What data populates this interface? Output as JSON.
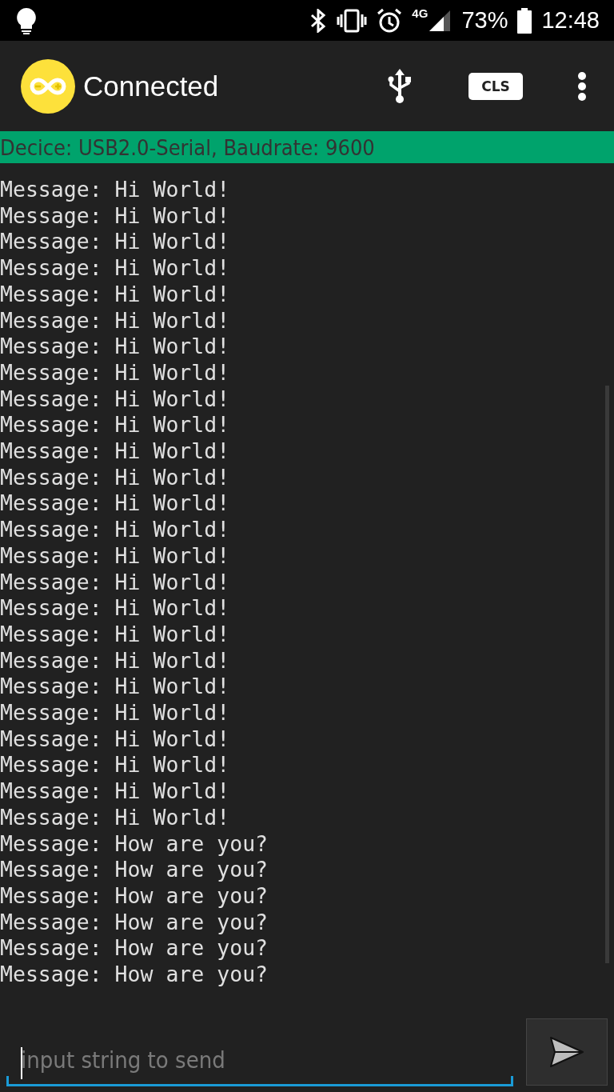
{
  "status_bar": {
    "network": "4G",
    "battery": "73%",
    "time": "12:48"
  },
  "app_bar": {
    "title": "Connected",
    "clear_button": "CLS"
  },
  "device_bar": {
    "text": "Decice: USB2.0-Serial, Baudrate: 9600"
  },
  "log": [
    "Message: Hi World!",
    "Message: Hi World!",
    "Message: Hi World!",
    "Message: Hi World!",
    "Message: Hi World!",
    "Message: Hi World!",
    "Message: Hi World!",
    "Message: Hi World!",
    "Message: Hi World!",
    "Message: Hi World!",
    "Message: Hi World!",
    "Message: Hi World!",
    "Message: Hi World!",
    "Message: Hi World!",
    "Message: Hi World!",
    "Message: Hi World!",
    "Message: Hi World!",
    "Message: Hi World!",
    "Message: Hi World!",
    "Message: Hi World!",
    "Message: Hi World!",
    "Message: Hi World!",
    "Message: Hi World!",
    "Message: Hi World!",
    "Message: Hi World!",
    "Message: How are you?",
    "Message: How are you?",
    "Message: How are you?",
    "Message: How are you?",
    "Message: How are you?",
    "Message: How are you?"
  ],
  "input": {
    "placeholder": "input string to send"
  }
}
